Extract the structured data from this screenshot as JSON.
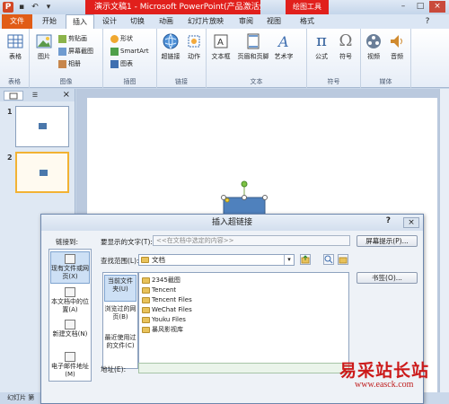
{
  "titlebar": {
    "doc_title": "演示文稿1 - Microsoft PowerPoint(产品激活失败)",
    "context_tool": "绘图工具",
    "qat_icons": [
      "powerpoint-icon",
      "save-icon",
      "undo-icon",
      "redo-icon"
    ]
  },
  "tabs": [
    "文件",
    "开始",
    "插入",
    "设计",
    "切换",
    "动画",
    "幻灯片放映",
    "审阅",
    "视图",
    "格式"
  ],
  "ribbon": {
    "groups": {
      "table": "表格",
      "images": "图像",
      "illustrations": "插图",
      "links": "链接",
      "text": "文本",
      "symbols": "符号",
      "media": "媒体"
    },
    "buttons": {
      "table": "表格",
      "picture": "图片",
      "clipart": "剪贴画",
      "screenshot": "屏幕截图",
      "album": "相册",
      "shapes": "形状",
      "smartart": "SmartArt",
      "chart": "图表",
      "hyperlink": "超链接",
      "action": "动作",
      "textbox": "文本框",
      "headerfooter": "页眉和页脚",
      "wordart": "艺术字",
      "formula": "公式",
      "symbol": "符号",
      "video": "视频",
      "audio": "音频"
    }
  },
  "leftpane": {
    "slide_numbers": [
      "1",
      "2"
    ]
  },
  "statusbar": {
    "text": "幻灯片 第"
  },
  "dialog": {
    "title": "插入超链接",
    "help": "?",
    "close": "×",
    "link_to_label": "链接到:",
    "display_text_label": "要显示的文字(T):",
    "display_text_placeholder": "<<在文档中选定的内容>>",
    "screentip_button": "屏幕提示(P)...",
    "link_items": [
      "现有文件或网页(X)",
      "本文档中的位置(A)",
      "新建文档(N)",
      "电子邮件地址(M)"
    ],
    "lookin_label": "查找范围(L):",
    "lookin_value": "文档",
    "bookmark_button": "书签(O)...",
    "nav_items": [
      "当前文件夹(U)",
      "浏览过的网页(B)",
      "最近使用过的文件(C)"
    ],
    "files": [
      "2345截图",
      "Tencent",
      "Tencent Files",
      "WeChat Files",
      "Youku Files",
      "暴风影视库"
    ],
    "address_label": "地址(E):"
  },
  "watermark": {
    "text": "易采站长站",
    "url": "www.easck.com"
  }
}
